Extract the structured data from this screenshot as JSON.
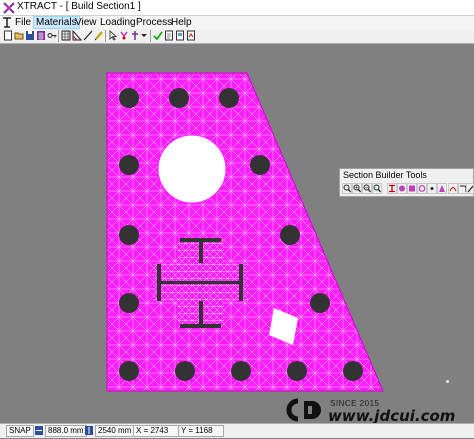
{
  "window": {
    "title": "XTRACT - [ Build Section1 ]"
  },
  "menu": {
    "items": [
      "File",
      "Materials",
      "View",
      "Loading",
      "Process",
      "Help"
    ],
    "active": "Materials"
  },
  "toolbar": {
    "icons": [
      "new-icon",
      "open-icon",
      "save-icon",
      "properties-icon",
      "key-icon",
      "grid-icon",
      "mesh-icon",
      "line-icon",
      "pencil-icon",
      "pointer-icon",
      "color-icon",
      "shape-icon",
      "dropdown-icon",
      "check-icon",
      "doc-icon",
      "page-icon",
      "export-icon"
    ]
  },
  "section_builder_tools": {
    "title": "Section Builder Tools",
    "tools": [
      "zoom-icon",
      "zoom-in-icon",
      "zoom-out-icon",
      "zoom-fit-icon",
      "ibeam-icon",
      "circle-icon",
      "rect-icon",
      "ring-icon",
      "point-icon",
      "polygon-icon",
      "arc-icon",
      "hook-icon",
      "bar-icon"
    ]
  },
  "status": {
    "snap": "SNAP",
    "width": "888.0 mm",
    "height": "2540 mm",
    "x": "X = 2743",
    "y": "Y = 1168"
  },
  "watermark": {
    "since": "SINCE 2015",
    "url": "www.jdcui.com"
  },
  "colors": {
    "section_fill": "#ff1dff",
    "mesh_line": "#ffffff",
    "bar": "#333333",
    "background": "#808080"
  }
}
